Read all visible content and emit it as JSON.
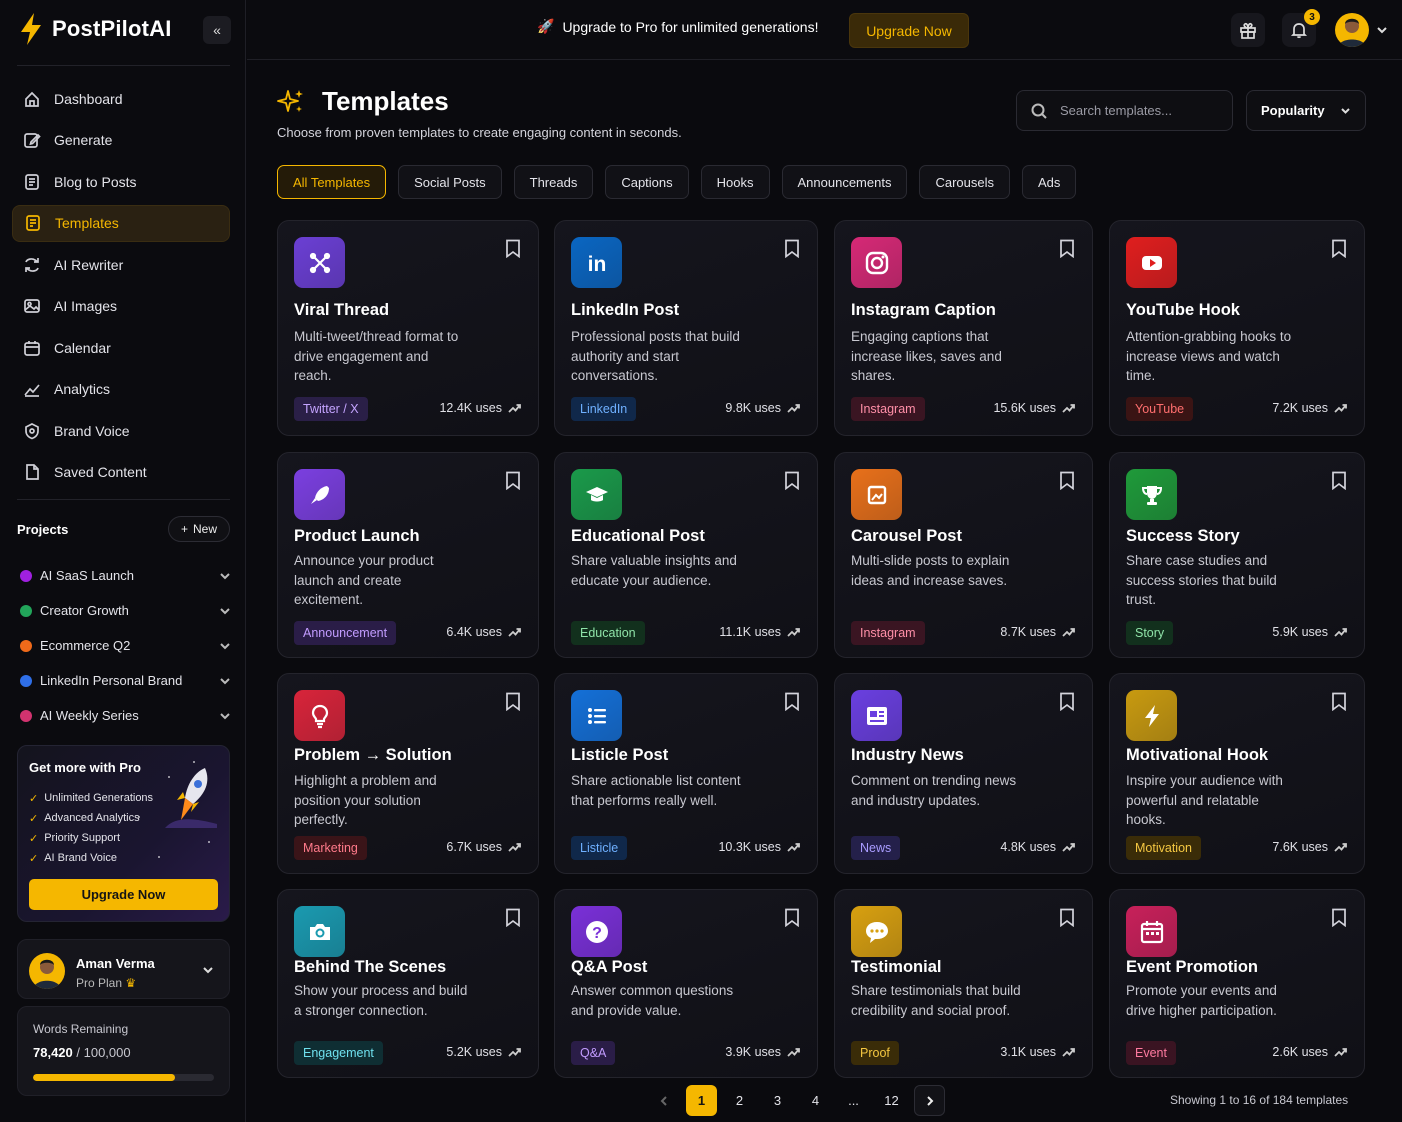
{
  "brand": {
    "name": "PostPilotAI",
    "accent": "#f5b700"
  },
  "sidebar": {
    "nav": [
      {
        "label": "Dashboard",
        "icon": "home-icon"
      },
      {
        "label": "Generate",
        "icon": "edit-icon"
      },
      {
        "label": "Blog to Posts",
        "icon": "document-icon"
      },
      {
        "label": "Templates",
        "icon": "template-icon",
        "active": true
      },
      {
        "label": "AI Rewriter",
        "icon": "rewrite-icon"
      },
      {
        "label": "AI Images",
        "icon": "image-icon"
      },
      {
        "label": "Calendar",
        "icon": "calendar-icon"
      },
      {
        "label": "Analytics",
        "icon": "analytics-icon"
      },
      {
        "label": "Brand Voice",
        "icon": "brand-voice-icon"
      },
      {
        "label": "Saved Content",
        "icon": "saved-icon"
      }
    ],
    "projects_title": "Projects",
    "new_label": "New",
    "projects": [
      {
        "name": "AI SaaS Launch",
        "color": "#a020e0"
      },
      {
        "name": "Creator Growth",
        "color": "#22a55a"
      },
      {
        "name": "Ecommerce Q2",
        "color": "#f06a1a"
      },
      {
        "name": "LinkedIn Personal Brand",
        "color": "#2f6fe8"
      },
      {
        "name": "AI Weekly Series",
        "color": "#d2336f"
      }
    ],
    "pro": {
      "title": "Get more with Pro",
      "features": [
        "Unlimited Generations",
        "Advanced Analytics",
        "Priority Support",
        "AI Brand Voice"
      ],
      "button": "Upgrade Now"
    },
    "user": {
      "name": "Aman Verma",
      "plan": "Pro Plan"
    },
    "words": {
      "label": "Words Remaining",
      "used": "78,420",
      "total": "/ 100,000",
      "fraction": 0.7842
    }
  },
  "topbar": {
    "promo": "Upgrade to Pro for unlimited generations!",
    "button": "Upgrade Now",
    "notifications": "3"
  },
  "main": {
    "title": "Templates",
    "subtitle": "Choose from proven templates to create engaging content in seconds.",
    "search_placeholder": "Search templates...",
    "sort": "Popularity",
    "tabs": [
      "All Templates",
      "Social Posts",
      "Threads",
      "Captions",
      "Hooks",
      "Announcements",
      "Carousels",
      "Ads"
    ],
    "cards": [
      {
        "title": "Viral Thread",
        "desc": "Multi-tweet/thread format to drive engagement and reach.",
        "tag": "Twitter / X",
        "uses": "12.4K uses",
        "icon": "thread-icon",
        "bg": "#6b3fd4",
        "tagbg": "#2a1f47",
        "tagfg": "#c4a4ff"
      },
      {
        "title": "LinkedIn Post",
        "desc": "Professional posts that build authority and start conversations.",
        "tag": "LinkedIn",
        "uses": "9.8K uses",
        "icon": "linkedin-icon",
        "bg": "#0a66c2",
        "tagbg": "#10284a",
        "tagfg": "#6fb0ff"
      },
      {
        "title": "Instagram Caption",
        "desc": "Engaging captions that increase likes, saves and shares.",
        "tag": "Instagram",
        "uses": "15.6K uses",
        "icon": "instagram-icon",
        "bg": "#d62976",
        "tagbg": "#3a1522",
        "tagfg": "#ff8fa8"
      },
      {
        "title": "YouTube Hook",
        "desc": "Attention-grabbing hooks to increase views and watch time.",
        "tag": "YouTube",
        "uses": "7.2K uses",
        "icon": "youtube-icon",
        "bg": "#e01e1e",
        "tagbg": "#3a1414",
        "tagfg": "#ff6e6e"
      },
      {
        "title": "Product Launch",
        "desc": "Announce your product launch and create excitement.",
        "tag": "Announcement",
        "uses": "6.4K uses",
        "icon": "rocket-icon",
        "bg": "#7b3fe0",
        "tagbg": "#2a1d47",
        "tagfg": "#c29cff"
      },
      {
        "title": "Educational Post",
        "desc": "Share valuable insights and educate your audience.",
        "tag": "Education",
        "uses": "11.1K uses",
        "icon": "graduation-cap-icon",
        "bg": "#1a9a4a",
        "tagbg": "#12301d",
        "tagfg": "#8fe3a8"
      },
      {
        "title": "Carousel Post",
        "desc": "Multi-slide posts to explain ideas and increase saves.",
        "tag": "Instagram",
        "uses": "8.7K uses",
        "icon": "carousel-icon",
        "bg": "#e8701a",
        "tagbg": "#3a1522",
        "tagfg": "#ff8fa8"
      },
      {
        "title": "Success Story",
        "desc": "Share case studies and success stories that build trust.",
        "tag": "Story",
        "uses": "5.9K uses",
        "icon": "trophy-icon",
        "bg": "#1f9a3a",
        "tagbg": "#12301d",
        "tagfg": "#8fe3a8"
      },
      {
        "title": "Problem → Solution",
        "desc": "Highlight a problem and position your solution perfectly.",
        "tag": "Marketing",
        "uses": "6.7K uses",
        "icon": "lightbulb-icon",
        "bg": "#d8243a",
        "tagbg": "#3a1418",
        "tagfg": "#ff7a8a"
      },
      {
        "title": "Listicle Post",
        "desc": "Share actionable list content that performs really well.",
        "tag": "Listicle",
        "uses": "10.3K uses",
        "icon": "list-icon",
        "bg": "#1470d8",
        "tagbg": "#10284a",
        "tagfg": "#6fb0ff"
      },
      {
        "title": "Industry News",
        "desc": "Comment on trending news and industry updates.",
        "tag": "News",
        "uses": "4.8K uses",
        "icon": "news-icon",
        "bg": "#6a3fe0",
        "tagbg": "#24204a",
        "tagfg": "#a99cff"
      },
      {
        "title": "Motivational Hook",
        "desc": "Inspire your audience with powerful and relatable hooks.",
        "tag": "Motivation",
        "uses": "7.6K uses",
        "icon": "lightning-icon",
        "bg": "#c89a10",
        "tagbg": "#3a2c08",
        "tagfg": "#f5c842"
      },
      {
        "title": "Behind The Scenes",
        "desc": "Show your process and build a stronger connection.",
        "tag": "Engagement",
        "uses": "5.2K uses",
        "icon": "camera-icon",
        "bg": "#1a9ab0",
        "tagbg": "#0f2e33",
        "tagfg": "#6fe0ee"
      },
      {
        "title": "Q&A Post",
        "desc": "Answer common questions and provide value.",
        "tag": "Q&A",
        "uses": "3.9K uses",
        "icon": "question-icon",
        "bg": "#7a30d8",
        "tagbg": "#2a1d47",
        "tagfg": "#c29cff"
      },
      {
        "title": "Testimonial",
        "desc": "Share testimonials that build credibility and social proof.",
        "tag": "Proof",
        "uses": "3.1K uses",
        "icon": "chat-bubble-icon",
        "bg": "#d8a010",
        "tagbg": "#3a2c08",
        "tagfg": "#f5c842"
      },
      {
        "title": "Event Promotion",
        "desc": "Promote your events and drive higher participation.",
        "tag": "Event",
        "uses": "2.6K uses",
        "icon": "calendar-event-icon",
        "bg": "#c8205a",
        "tagbg": "#3a1422",
        "tagfg": "#ff7aa0"
      }
    ],
    "pagination": {
      "pages": [
        "1",
        "2",
        "3",
        "4",
        "...",
        "12"
      ],
      "current": "1"
    },
    "showing": "Showing 1 to 16 of 184 templates"
  }
}
